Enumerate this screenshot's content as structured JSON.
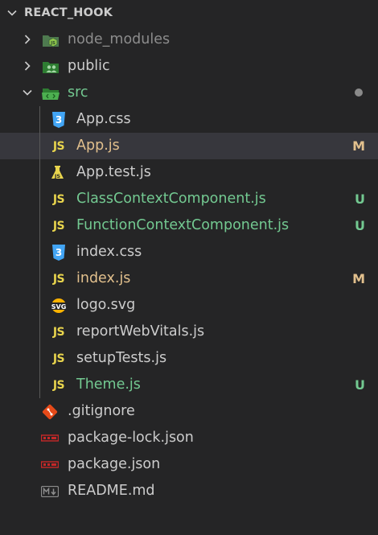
{
  "explorer": {
    "section_title": "REACT_HOOK",
    "items": [
      {
        "label": "node_modules",
        "icon": "node-folder-icon"
      },
      {
        "label": "public",
        "icon": "public-folder-icon"
      },
      {
        "label": "src",
        "icon": "src-folder-icon"
      },
      {
        "label": "App.css",
        "icon": "css-icon"
      },
      {
        "label": "App.js",
        "icon": "js-icon",
        "badge": "M"
      },
      {
        "label": "App.test.js",
        "icon": "test-icon"
      },
      {
        "label": "ClassContextComponent.js",
        "icon": "js-icon",
        "badge": "U"
      },
      {
        "label": "FunctionContextComponent.js",
        "icon": "js-icon",
        "badge": "U"
      },
      {
        "label": "index.css",
        "icon": "css-icon"
      },
      {
        "label": "index.js",
        "icon": "js-icon",
        "badge": "M"
      },
      {
        "label": "logo.svg",
        "icon": "svg-icon"
      },
      {
        "label": "reportWebVitals.js",
        "icon": "js-icon"
      },
      {
        "label": "setupTests.js",
        "icon": "js-icon"
      },
      {
        "label": "Theme.js",
        "icon": "js-icon",
        "badge": "U"
      },
      {
        "label": ".gitignore",
        "icon": "git-icon"
      },
      {
        "label": "package-lock.json",
        "icon": "npm-icon"
      },
      {
        "label": "package.json",
        "icon": "npm-icon"
      },
      {
        "label": "README.md",
        "icon": "markdown-icon"
      }
    ],
    "js_icon_text": "JS",
    "svg_icon_text": "SVG",
    "colors": {
      "background": "#252526",
      "selected_row": "#37373d",
      "modified": "#e2c08d",
      "untracked": "#73c991",
      "default_text": "#cccccc",
      "ignored_text": "#8c8c8c",
      "js_icon": "#e8d44d",
      "css_icon": "#42a5f5"
    }
  }
}
